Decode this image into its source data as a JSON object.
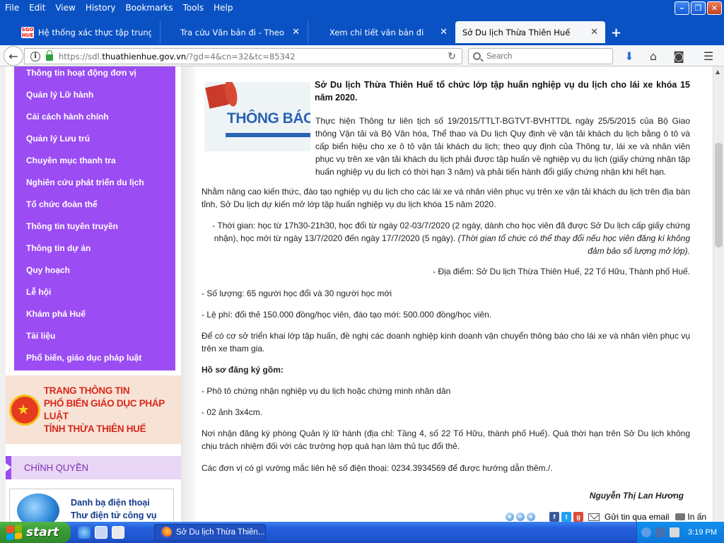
{
  "menubar": {
    "items": [
      "File",
      "Edit",
      "View",
      "History",
      "Bookmarks",
      "Tools",
      "Help"
    ]
  },
  "tabs": [
    {
      "title": "Hệ thống xác thực tập trung ...",
      "favicon": "SGO HUE"
    },
    {
      "title": "Tra cứu Văn bản đi - Theo ng..."
    },
    {
      "title": "Xem chi tiết văn bản đi"
    },
    {
      "title": "Sở Du lịch Thừa Thiên Huế"
    }
  ],
  "newtab_label": "+",
  "url": {
    "prefix": "https://sdl.",
    "domain": "thuathienhue.gov.vn",
    "path": "/?gd=4&cn=32&tc=85342"
  },
  "search": {
    "placeholder": "Search"
  },
  "sidebar": {
    "items": [
      "Thông tin hoạt động đơn vị",
      "Quản lý Lữ hành",
      "Cải cách hành chính",
      "Quản lý Lưu trú",
      "Chuyên mục thanh tra",
      "Nghiên cứu phát triển du lịch",
      "Tổ chức đoàn thể",
      "Thông tin tuyên truyền",
      "Thông tin dự án",
      "Quy hoạch",
      "Lễ hội",
      "Khám phá Huế",
      "Tài liệu",
      "Phổ biến, giáo dục pháp luật"
    ],
    "banner_lines": [
      "TRANG THÔNG TIN",
      "PHỔ BIẾN GIÁO DỤC PHÁP LUẬT",
      "TỈNH THỪA THIÊN HUẾ"
    ],
    "section_title": "CHÍNH QUYỀN",
    "directory_lines": [
      "Danh bạ điện thoại",
      "Thư điện tử công vụ"
    ]
  },
  "article": {
    "thumbnail_word": "THÔNG BÁO",
    "title": "Sở Du lịch Thừa Thiên Huế tổ chức lớp tập huấn nghiệp vụ du lịch cho lái xe khóa 15 năm 2020.",
    "intro": "Thực hiện Thông tư liên tịch số 19/2015/TTLT-BGTVT-BVHTTDL ngày 25/5/2015 của Bộ Giao thông Vận tải và Bộ Văn hóa, Thể thao và Du lịch Quy định về vận tải khách du lịch bằng ô tô và cấp biển hiệu cho xe ô tô vận tải khách du lịch; theo quy định của Thông tư, lái xe và nhân viên phục vụ trên xe vận tải khách du lịch phải được tập huấn về nghiệp vụ du lịch (giấy chứng nhận tập huấn nghiệp vụ du lịch có thời hạn 3 năm) và phải tiến hành đổi giấy chứng nhận khi hết hạn.",
    "p2": "Nhằm nâng cao kiến thức, đào tạo nghiệp vụ du lịch cho các lái xe và nhân viên phục vụ trên xe vận tải khách du lịch trên địa bàn tỉnh, Sở Du lịch dự kiến mở lớp tập huấn nghiệp vụ du lịch khóa 15 năm 2020.",
    "time_text": "- Thời gian: học từ 17h30-21h30, học đổi từ ngày 02-03/7/2020 (2 ngày, dành cho học viên đã được Sở Du lịch cấp giấy chứng nhận), học mới từ ngày 13/7/2020 đến ngày 17/7/2020 (5 ngày).",
    "time_note": "(Thời gian tổ chức có thể thay đổi nếu học viên đăng kí không đảm bảo số lượng mở lớp).",
    "location": "- Địa điểm: Sở Du lịch Thừa Thiên Huế, 22 Tố Hữu, Thành phố Huế.",
    "quantity": "- Số lượng: 65 người học đổi và 30 người học mới",
    "fee": "- Lệ phí: đổi thẻ 150.000 đồng/học viên, đào tạo mới: 500.000 đồng/học viên.",
    "request": "Để có cơ sở triển khai lớp tập huấn, đề nghị các doanh nghiệp kinh doanh vận chuyển thông báo cho lái xe và nhân viên phục vụ trên xe tham gia.",
    "docs_heading": "Hồ sơ đăng ký gồm:",
    "doc1": "- Phô tô chứng nhận nghiệp vụ du lịch hoặc chứng minh nhân dân",
    "doc2": "- 02 ảnh 3x4cm.",
    "receive": "Nơi nhận đăng ký phòng Quản lý lữ hành (địa chỉ: Tầng 4, số 22 Tố Hữu, thành phố Huế). Quá thời hạn trên Sở Du lịch không chịu trách nhiệm đối với các trường hợp quá hạn làm thủ tục đổi thẻ.",
    "contact": "Các đơn vị có gì vướng mắc liên hệ số điện thoại: 0234.3934569 để được hướng dẫn thêm./.",
    "author": "Nguyễn Thị Lan Hương",
    "email_label": "Gửi tin qua email",
    "print_label": "In ấn"
  },
  "taskbar": {
    "start_label": "start",
    "task_title": "Sở Du lịch Thừa Thiên...",
    "clock": "3:19 PM"
  },
  "colors": {
    "sidebar": "#9b4cf3",
    "titlebar": "#0a52c4",
    "banner_red": "#d8281a"
  }
}
